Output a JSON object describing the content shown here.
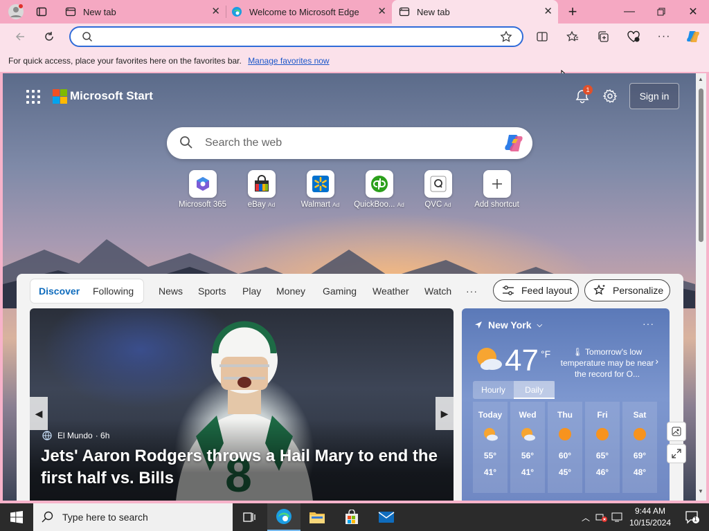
{
  "browser": {
    "tabs": [
      {
        "title": "New tab",
        "active": false
      },
      {
        "title": "Welcome to Microsoft Edge",
        "active": false
      },
      {
        "title": "New tab",
        "active": true
      }
    ],
    "address": {
      "value": "",
      "placeholder": ""
    },
    "favorites_bar": {
      "message": "For quick access, place your favorites here on the favorites bar.",
      "link": "Manage favorites now"
    },
    "accent": "#f5a8c2"
  },
  "ms_start": {
    "brand": "Microsoft Start",
    "notification_count": "1",
    "sign_in": "Sign in",
    "search_placeholder": "Search the web",
    "shortcuts": [
      {
        "label": "Microsoft 365",
        "ad": ""
      },
      {
        "label": "eBay",
        "ad": "Ad"
      },
      {
        "label": "Walmart",
        "ad": "Ad"
      },
      {
        "label": "QuickBoo...",
        "ad": "Ad"
      },
      {
        "label": "QVC",
        "ad": "Ad"
      },
      {
        "label": "Add shortcut",
        "ad": ""
      }
    ],
    "feed_tabs": [
      "Discover",
      "Following",
      "News",
      "Sports",
      "Play",
      "Money",
      "Gaming",
      "Weather",
      "Watch"
    ],
    "more_tabs": "···",
    "feed_layout": "Feed layout",
    "personalize": "Personalize",
    "hero": {
      "source": "El Mundo",
      "age": "· 6h",
      "headline": "Jets' Aaron Rodgers throws a Hail Mary to end the first half vs. Bills"
    },
    "weather": {
      "location": "New York",
      "temp": "47",
      "unit": "°F",
      "note": "Tomorrow's low temperature may be near the record for O...",
      "toggle": [
        "Hourly",
        "Daily"
      ],
      "days": [
        {
          "name": "Today",
          "high": "55°",
          "low": "41°",
          "icon": "partly-sunny-icon"
        },
        {
          "name": "Wed",
          "high": "56°",
          "low": "41°",
          "icon": "partly-sunny-icon"
        },
        {
          "name": "Thu",
          "high": "60°",
          "low": "45°",
          "icon": "sunny-icon"
        },
        {
          "name": "Fri",
          "high": "65°",
          "low": "46°",
          "icon": "sunny-icon"
        },
        {
          "name": "Sat",
          "high": "69°",
          "low": "48°",
          "icon": "sunny-icon"
        }
      ]
    }
  },
  "taskbar": {
    "search_placeholder": "Type here to search",
    "time": "9:44 AM",
    "date": "10/15/2024",
    "notification_count": "1"
  }
}
